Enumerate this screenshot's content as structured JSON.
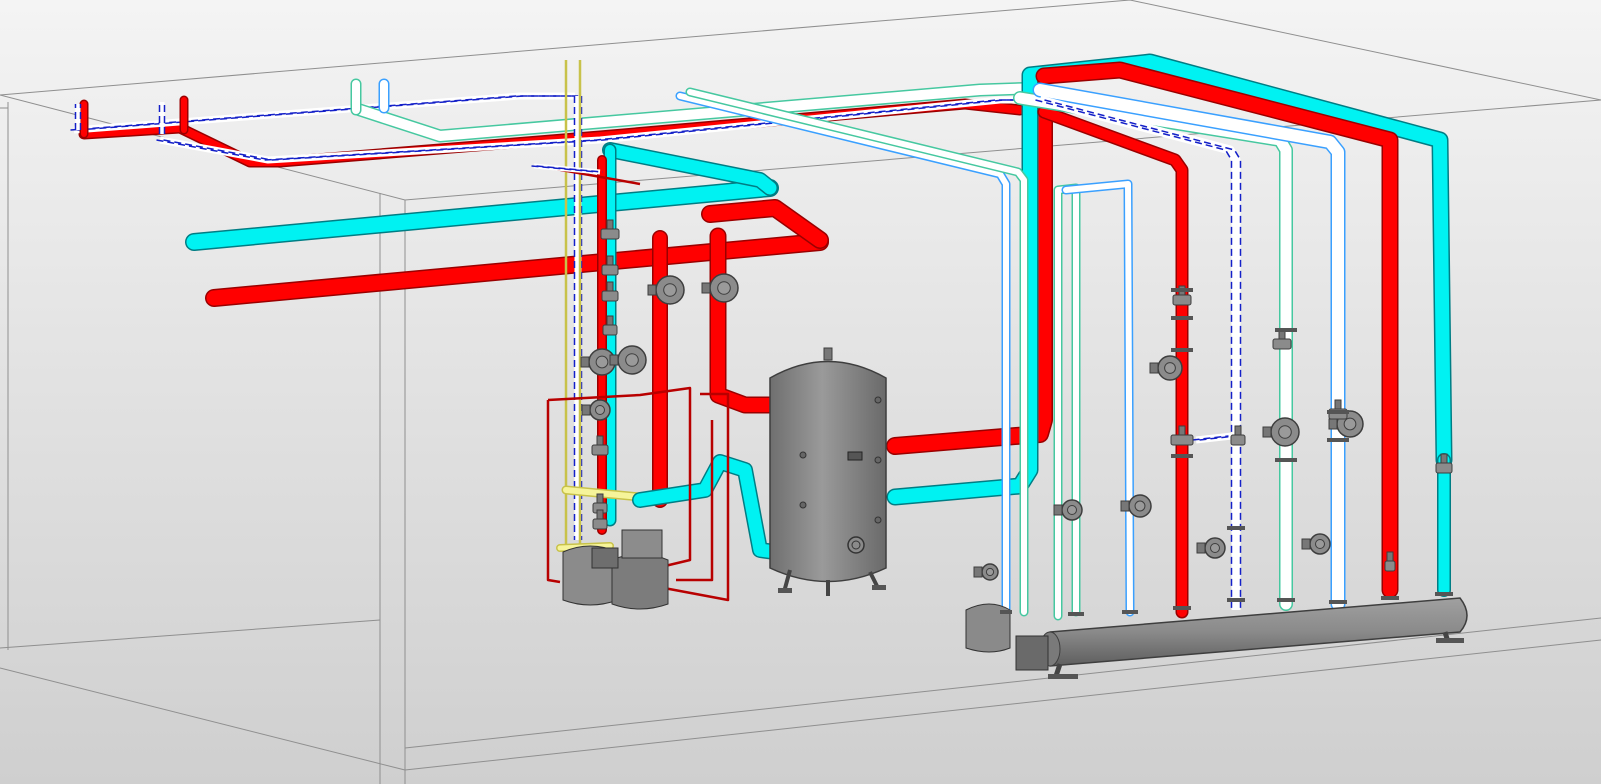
{
  "viewport": {
    "background_top": "#f4f4f4",
    "background_bottom": "#cfcfcf"
  },
  "colors": {
    "hot_pipe": "#ff0000",
    "hot_pipe_edge": "#9a0000",
    "cold_pipe": "#00f2f2",
    "cold_pipe_edge": "#007d84",
    "white_pipe": "#ffffff",
    "white_pipe_edge": "#3aa0ff",
    "mint_pipe_edge": "#46c8a0",
    "yellow_pipe": "#f6f49a",
    "yellow_pipe_edge": "#c8c24a",
    "dashed_pipe": "#1420c8",
    "thin_red_pipe": "#b80000",
    "equipment": "#8b8b8b",
    "equipment_edge": "#3e3e3e",
    "room_outline": "#8f8f8f"
  },
  "equipment": {
    "storage_tank": "storage-tank",
    "distribution_manifold": "distribution-manifold",
    "boiler_units": "boiler-units",
    "pumps": "circulation-pumps",
    "valves": "valve-fittings"
  }
}
